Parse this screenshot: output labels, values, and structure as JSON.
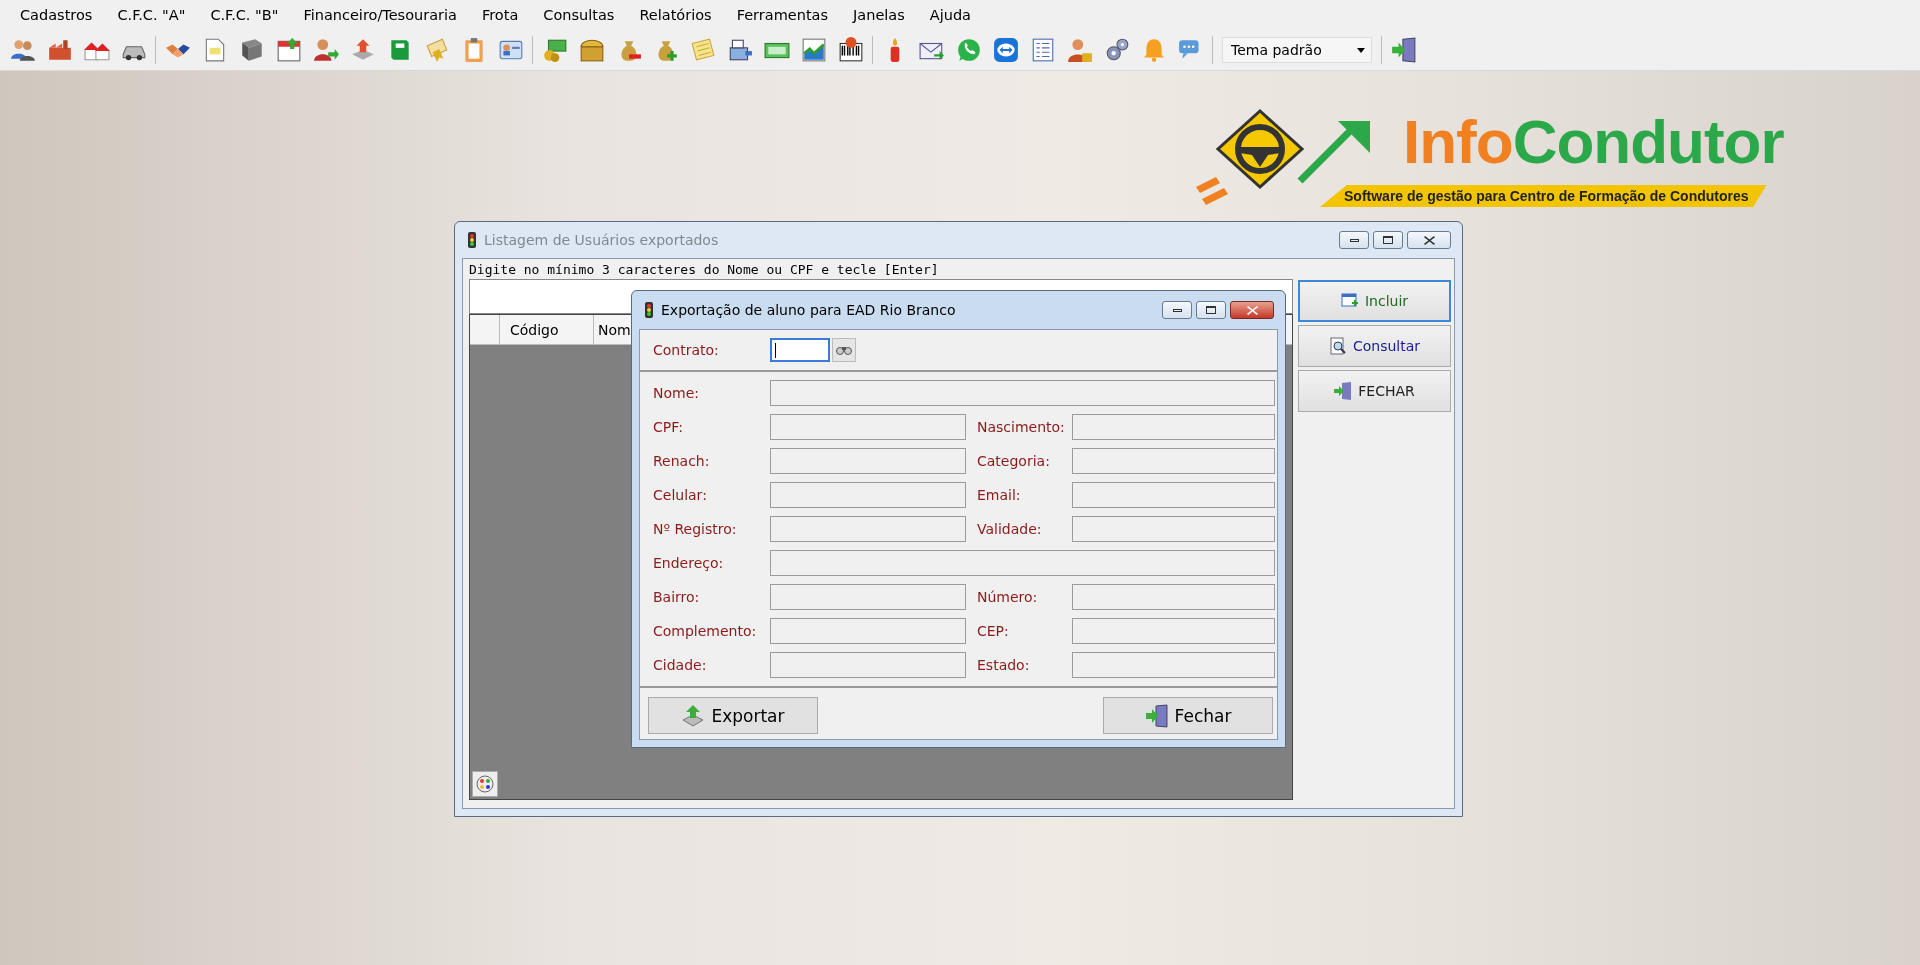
{
  "menu": [
    "Cadastros",
    "C.F.C. \"A\"",
    "C.F.C. \"B\"",
    "Financeiro/Tesouraria",
    "Frota",
    "Consultas",
    "Relatórios",
    "Ferramentas",
    "Janelas",
    "Ajuda"
  ],
  "toolbar": {
    "theme_combo": "Tema padrão"
  },
  "logo": {
    "wordmark": [
      "Info",
      "Condutor"
    ],
    "tagline": "Software de gestão para Centro de Formação de Condutores"
  },
  "list_window": {
    "title": "Listagem de Usuários exportados",
    "active": false,
    "hint": "Digite no mínimo 3 caracteres do Nome ou CPF e tecle [Enter]",
    "columns": [
      "Código",
      "Nom"
    ],
    "buttons": [
      {
        "label": "Incluir",
        "default": true,
        "color": "#1a6e1a"
      },
      {
        "label": "Consultar",
        "default": false,
        "color": "#1a1a9a"
      },
      {
        "label": "FECHAR",
        "default": false,
        "color": "#202020"
      }
    ]
  },
  "export_dialog": {
    "title": "Exportação de aluno para EAD Rio Branco",
    "active": true,
    "contrato": {
      "label": "Contrato:",
      "focused": true
    },
    "rows": [
      [
        {
          "label": "Nome:"
        }
      ],
      [
        {
          "label": "CPF:"
        },
        {
          "label": "Nascimento:"
        }
      ],
      [
        {
          "label": "Renach:"
        },
        {
          "label": "Categoria:"
        }
      ],
      [
        {
          "label": "Celular:"
        },
        {
          "label": "Email:"
        }
      ],
      [
        {
          "label": "Nº Registro:"
        },
        {
          "label": "Validade:"
        }
      ],
      [
        {
          "label": "Endereço:"
        }
      ],
      [
        {
          "label": "Bairro:"
        },
        {
          "label": "Número:"
        }
      ],
      [
        {
          "label": "Complemento:"
        },
        {
          "label": "CEP:"
        }
      ],
      [
        {
          "label": "Cidade:"
        },
        {
          "label": "Estado:"
        }
      ]
    ],
    "buttons": [
      "Exportar",
      "Fechar"
    ]
  }
}
